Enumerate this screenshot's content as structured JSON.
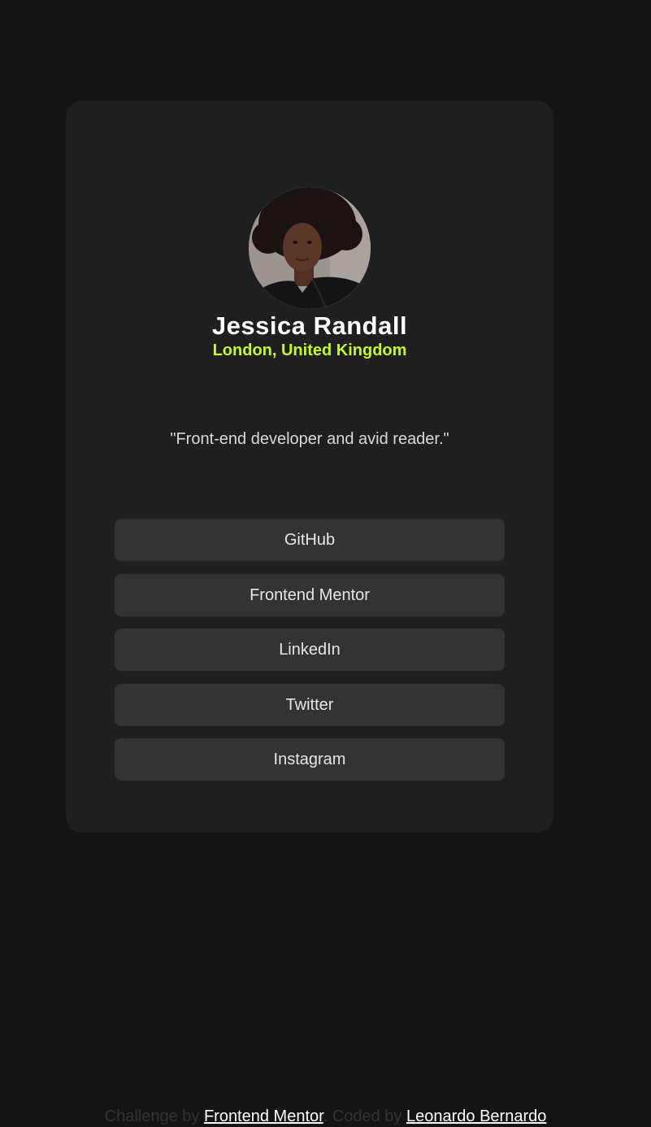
{
  "colors": {
    "page_bg": "#141414",
    "card_bg": "#1f1f1f",
    "button_bg": "#333333",
    "accent": "#c4f82a",
    "text_white": "#ffffff",
    "text_muted": "#333333"
  },
  "profile": {
    "avatar": "profile-photo",
    "name": "Jessica Randall",
    "location": "London, United Kingdom",
    "bio": "\"Front-end developer and avid reader.\""
  },
  "links": [
    {
      "label": "GitHub"
    },
    {
      "label": "Frontend Mentor"
    },
    {
      "label": "LinkedIn"
    },
    {
      "label": "Twitter"
    },
    {
      "label": "Instagram"
    }
  ],
  "footer": {
    "prefix": "Challenge by",
    "challenge_link": "Frontend Mentor",
    "middle": "Coded by",
    "author_link": "Leonardo Bernardo"
  }
}
